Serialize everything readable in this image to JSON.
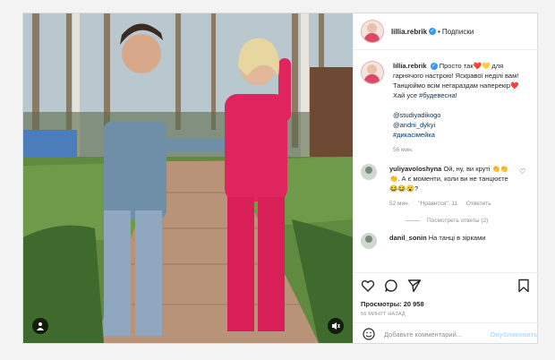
{
  "header": {
    "username": "lillia.rebrik",
    "verified_mark": "✓",
    "separator": "•",
    "follow_label": "Подписки"
  },
  "caption": {
    "username": "lillia.rebrik",
    "text_a": "Просто так",
    "text_b": " для гарнячого настрою! Яскравої неділі вам! Танцюймо всім негараздам наперекір",
    "text_c": " Хай усе ",
    "hashtag1": "#будевесна",
    "text_d": "!",
    "mention1": "@studiyadikogo",
    "mention2": "@andrii_dykyi",
    "hashtag2": "#дикасімейка",
    "time": "56 мин."
  },
  "comment": {
    "username": "yuliyavoloshyna",
    "text": " Ой, ну, ви круті 👏👏👏. А є моменти, коли ви не танцюєте😂😂😮?",
    "time": "52 мин.",
    "likes": "\"Нравится\": 11",
    "reply": "Ответить",
    "view_replies": "Посмотреть ответы (2)"
  },
  "comment2": {
    "username": "danil_sonin",
    "text": " На танці в зірками"
  },
  "stats": {
    "views": "Просмотры: 20 958",
    "posted_ago": "56 МИНУТ НАЗАД"
  },
  "add_comment": {
    "placeholder": "Добавьте комментарий...",
    "publish_label": "Опубликовать"
  },
  "colors": {
    "accent_blue": "#3897f0",
    "publish_disabled": "#b2dffc",
    "outfit_red": "#e0245e"
  },
  "icons": [
    "heart-icon",
    "comment-icon",
    "share-icon",
    "bookmark-icon",
    "emoji-icon",
    "user-tag-icon",
    "audio-icon"
  ]
}
